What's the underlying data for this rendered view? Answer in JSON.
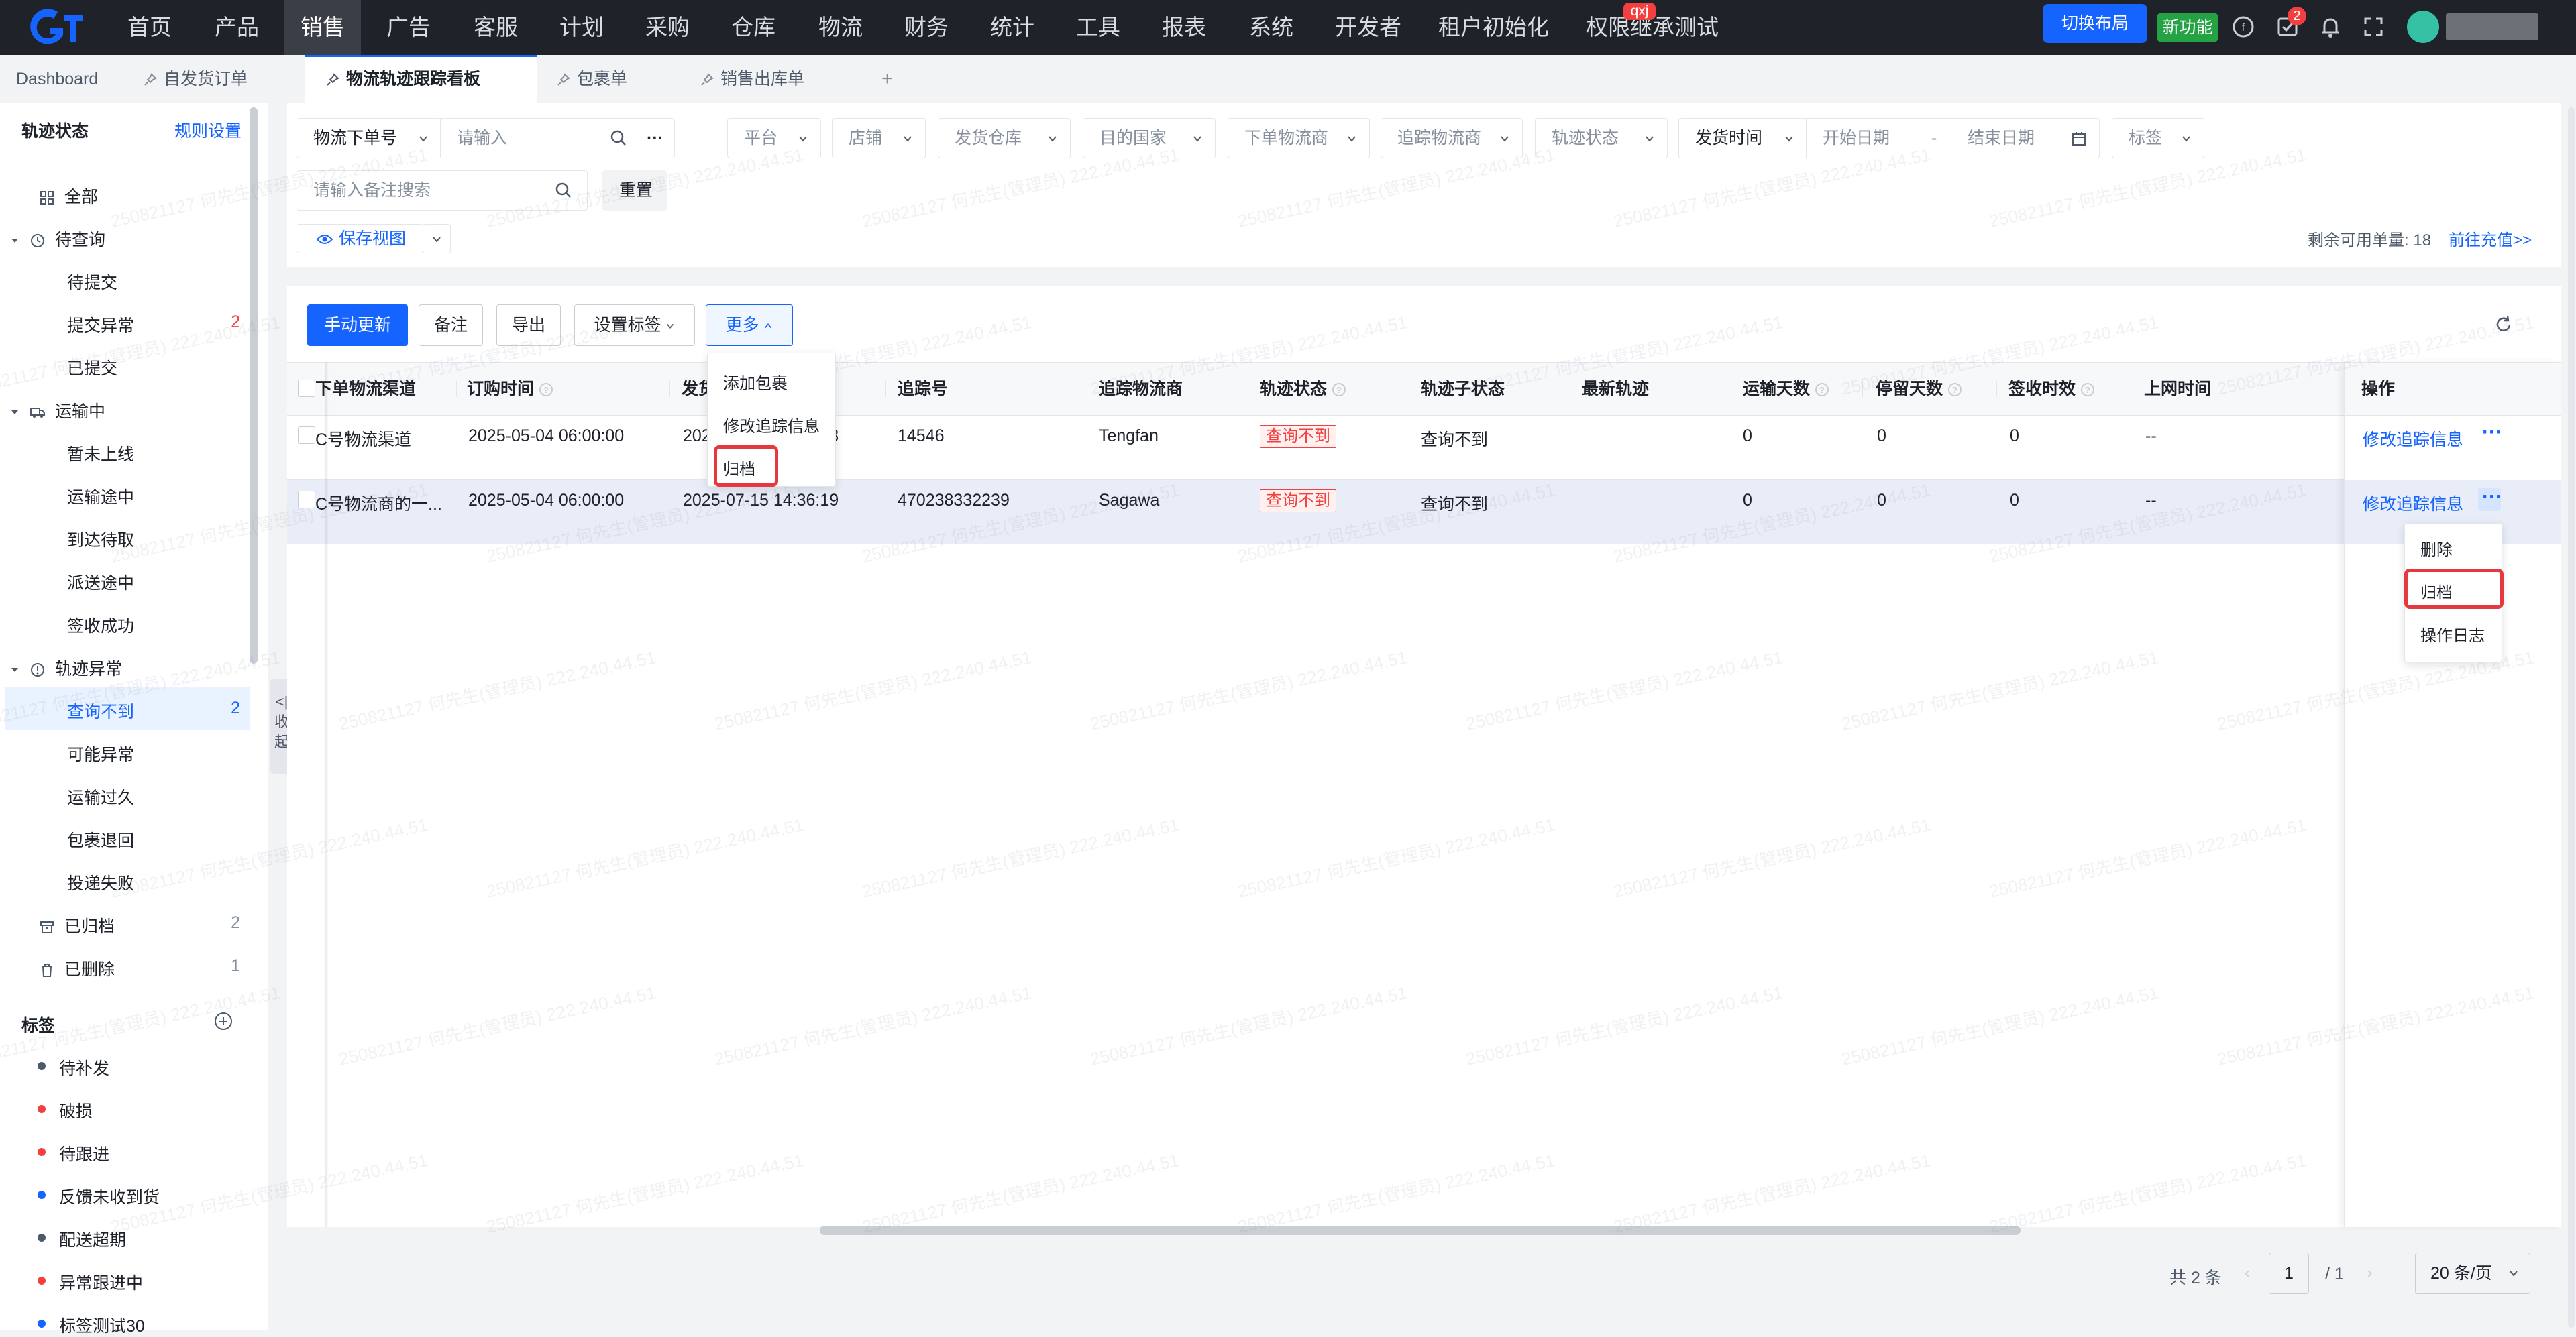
{
  "topnav": {
    "items": [
      "首页",
      "产品",
      "销售",
      "广告",
      "客服",
      "计划",
      "采购",
      "仓库",
      "物流",
      "财务",
      "统计",
      "工具",
      "报表",
      "系统",
      "开发者",
      "租户初始化",
      "权限继承测试"
    ],
    "active": "销售",
    "badge_text": "qxj",
    "switch_layout": "切换布局",
    "new_feature": "新功能",
    "task_badge": "2"
  },
  "tabs": {
    "dashboard": "Dashboard",
    "items": [
      "自发货订单",
      "物流轨迹跟踪看板",
      "包裹单",
      "销售出库单"
    ],
    "active": "物流轨迹跟踪看板",
    "add": "+"
  },
  "sidebar": {
    "title": "轨迹状态",
    "rules_link": "规则设置",
    "all": "全部",
    "groups": [
      {
        "label": "待查询",
        "children": [
          {
            "label": "待提交",
            "count": ""
          },
          {
            "label": "提交异常",
            "count": "2"
          },
          {
            "label": "已提交",
            "count": ""
          }
        ]
      },
      {
        "label": "运输中",
        "children": [
          {
            "label": "暂未上线",
            "count": ""
          },
          {
            "label": "运输途中",
            "count": ""
          },
          {
            "label": "到达待取",
            "count": ""
          },
          {
            "label": "派送途中",
            "count": ""
          },
          {
            "label": "签收成功",
            "count": ""
          }
        ]
      },
      {
        "label": "轨迹异常",
        "children": [
          {
            "label": "查询不到",
            "count": "2"
          },
          {
            "label": "可能异常",
            "count": ""
          },
          {
            "label": "运输过久",
            "count": ""
          },
          {
            "label": "包裹退回",
            "count": ""
          },
          {
            "label": "投递失败",
            "count": ""
          }
        ]
      }
    ],
    "archived": {
      "label": "已归档",
      "count": "2"
    },
    "deleted": {
      "label": "已删除",
      "count": "1"
    },
    "tags_title": "标签",
    "tags": [
      {
        "label": "待补发",
        "color": "#4e5969"
      },
      {
        "label": "破损",
        "color": "#f53f3f"
      },
      {
        "label": "待跟进",
        "color": "#f53f3f"
      },
      {
        "label": "反馈未收到货",
        "color": "#1664ff"
      },
      {
        "label": "配送超期",
        "color": "#4e5969"
      },
      {
        "label": "异常跟进中",
        "color": "#f53f3f"
      },
      {
        "label": "标签测试30",
        "color": "#1664ff"
      }
    ],
    "collapse": "收起"
  },
  "filters": {
    "order_type": "物流下单号",
    "input_placeholder": "请输入",
    "platform": "平台",
    "store": "店铺",
    "warehouse": "发货仓库",
    "country": "目的国家",
    "order_carrier": "下单物流商",
    "track_carrier": "追踪物流商",
    "track_status": "轨迹状态",
    "ship_time": "发货时间",
    "start_date": "开始日期",
    "date_sep": "-",
    "end_date": "结束日期",
    "tag": "标签",
    "remark_placeholder": "请输入备注搜索",
    "reset": "重置",
    "save_view": "保存视图",
    "remaining_label": "剩余可用单量:",
    "remaining_value": "18",
    "recharge": "前往充值>>"
  },
  "toolbar": {
    "manual_update": "手动更新",
    "remark": "备注",
    "export": "导出",
    "set_tag": "设置标签",
    "more": "更多"
  },
  "more_menu": [
    "添加包裹",
    "修改追踪信息",
    "归档"
  ],
  "table": {
    "headers": [
      "下单物流渠道",
      "订购时间",
      "发货时间",
      "追踪号",
      "追踪物流商",
      "轨迹状态",
      "轨迹子状态",
      "最新轨迹",
      "运输天数",
      "停留天数",
      "签收时效",
      "上网时间",
      "操作"
    ],
    "rows": [
      {
        "channel": "C号物流渠道",
        "order_time": "2025-05-04 06:00:00",
        "ship_time": "2025-07-15 14:36:18",
        "tracking": "14546",
        "carrier": "Tengfan",
        "status": "查询不到",
        "sub_status": "查询不到",
        "transit_days": "0",
        "stay_days": "0",
        "sign_time": "0",
        "online_time": "--",
        "action": "修改追踪信息"
      },
      {
        "channel": "C号物流商的一...",
        "order_time": "2025-05-04 06:00:00",
        "ship_time": "2025-07-15 14:36:19",
        "tracking": "470238332239",
        "carrier": "Sagawa",
        "status": "查询不到",
        "sub_status": "查询不到",
        "transit_days": "0",
        "stay_days": "0",
        "sign_time": "0",
        "online_time": "--",
        "action": "修改追踪信息"
      }
    ]
  },
  "row_menu": [
    "删除",
    "归档",
    "操作日志"
  ],
  "pagination": {
    "total": "共 2 条",
    "page": "1",
    "of": "/ 1",
    "page_size": "20 条/页"
  },
  "watermark": "250821127 何先生(管理员) 222.240.44.51"
}
